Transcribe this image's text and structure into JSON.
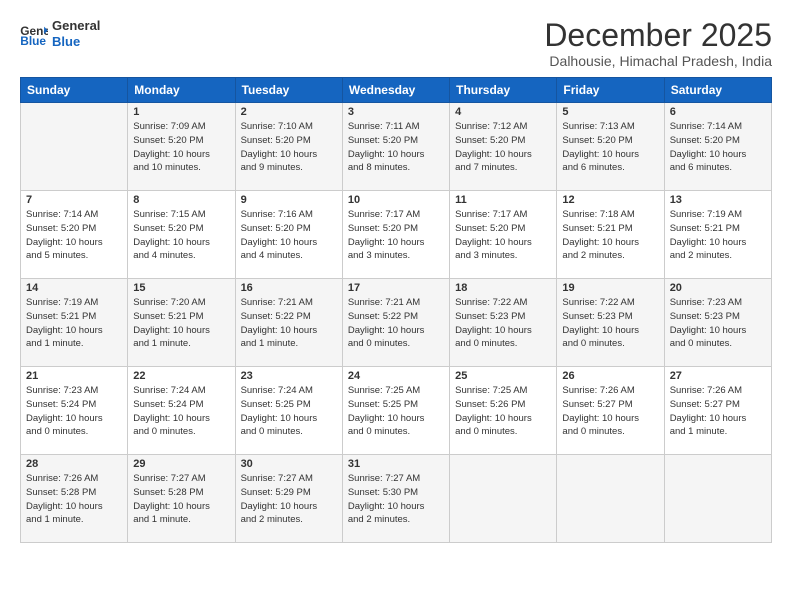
{
  "logo": {
    "line1": "General",
    "line2": "Blue"
  },
  "title": "December 2025",
  "location": "Dalhousie, Himachal Pradesh, India",
  "weekdays": [
    "Sunday",
    "Monday",
    "Tuesday",
    "Wednesday",
    "Thursday",
    "Friday",
    "Saturday"
  ],
  "weeks": [
    [
      {
        "day": "",
        "info": ""
      },
      {
        "day": "1",
        "info": "Sunrise: 7:09 AM\nSunset: 5:20 PM\nDaylight: 10 hours\nand 10 minutes."
      },
      {
        "day": "2",
        "info": "Sunrise: 7:10 AM\nSunset: 5:20 PM\nDaylight: 10 hours\nand 9 minutes."
      },
      {
        "day": "3",
        "info": "Sunrise: 7:11 AM\nSunset: 5:20 PM\nDaylight: 10 hours\nand 8 minutes."
      },
      {
        "day": "4",
        "info": "Sunrise: 7:12 AM\nSunset: 5:20 PM\nDaylight: 10 hours\nand 7 minutes."
      },
      {
        "day": "5",
        "info": "Sunrise: 7:13 AM\nSunset: 5:20 PM\nDaylight: 10 hours\nand 6 minutes."
      },
      {
        "day": "6",
        "info": "Sunrise: 7:14 AM\nSunset: 5:20 PM\nDaylight: 10 hours\nand 6 minutes."
      }
    ],
    [
      {
        "day": "7",
        "info": "Sunrise: 7:14 AM\nSunset: 5:20 PM\nDaylight: 10 hours\nand 5 minutes."
      },
      {
        "day": "8",
        "info": "Sunrise: 7:15 AM\nSunset: 5:20 PM\nDaylight: 10 hours\nand 4 minutes."
      },
      {
        "day": "9",
        "info": "Sunrise: 7:16 AM\nSunset: 5:20 PM\nDaylight: 10 hours\nand 4 minutes."
      },
      {
        "day": "10",
        "info": "Sunrise: 7:17 AM\nSunset: 5:20 PM\nDaylight: 10 hours\nand 3 minutes."
      },
      {
        "day": "11",
        "info": "Sunrise: 7:17 AM\nSunset: 5:20 PM\nDaylight: 10 hours\nand 3 minutes."
      },
      {
        "day": "12",
        "info": "Sunrise: 7:18 AM\nSunset: 5:21 PM\nDaylight: 10 hours\nand 2 minutes."
      },
      {
        "day": "13",
        "info": "Sunrise: 7:19 AM\nSunset: 5:21 PM\nDaylight: 10 hours\nand 2 minutes."
      }
    ],
    [
      {
        "day": "14",
        "info": "Sunrise: 7:19 AM\nSunset: 5:21 PM\nDaylight: 10 hours\nand 1 minute."
      },
      {
        "day": "15",
        "info": "Sunrise: 7:20 AM\nSunset: 5:21 PM\nDaylight: 10 hours\nand 1 minute."
      },
      {
        "day": "16",
        "info": "Sunrise: 7:21 AM\nSunset: 5:22 PM\nDaylight: 10 hours\nand 1 minute."
      },
      {
        "day": "17",
        "info": "Sunrise: 7:21 AM\nSunset: 5:22 PM\nDaylight: 10 hours\nand 0 minutes."
      },
      {
        "day": "18",
        "info": "Sunrise: 7:22 AM\nSunset: 5:23 PM\nDaylight: 10 hours\nand 0 minutes."
      },
      {
        "day": "19",
        "info": "Sunrise: 7:22 AM\nSunset: 5:23 PM\nDaylight: 10 hours\nand 0 minutes."
      },
      {
        "day": "20",
        "info": "Sunrise: 7:23 AM\nSunset: 5:23 PM\nDaylight: 10 hours\nand 0 minutes."
      }
    ],
    [
      {
        "day": "21",
        "info": "Sunrise: 7:23 AM\nSunset: 5:24 PM\nDaylight: 10 hours\nand 0 minutes."
      },
      {
        "day": "22",
        "info": "Sunrise: 7:24 AM\nSunset: 5:24 PM\nDaylight: 10 hours\nand 0 minutes."
      },
      {
        "day": "23",
        "info": "Sunrise: 7:24 AM\nSunset: 5:25 PM\nDaylight: 10 hours\nand 0 minutes."
      },
      {
        "day": "24",
        "info": "Sunrise: 7:25 AM\nSunset: 5:25 PM\nDaylight: 10 hours\nand 0 minutes."
      },
      {
        "day": "25",
        "info": "Sunrise: 7:25 AM\nSunset: 5:26 PM\nDaylight: 10 hours\nand 0 minutes."
      },
      {
        "day": "26",
        "info": "Sunrise: 7:26 AM\nSunset: 5:27 PM\nDaylight: 10 hours\nand 0 minutes."
      },
      {
        "day": "27",
        "info": "Sunrise: 7:26 AM\nSunset: 5:27 PM\nDaylight: 10 hours\nand 1 minute."
      }
    ],
    [
      {
        "day": "28",
        "info": "Sunrise: 7:26 AM\nSunset: 5:28 PM\nDaylight: 10 hours\nand 1 minute."
      },
      {
        "day": "29",
        "info": "Sunrise: 7:27 AM\nSunset: 5:28 PM\nDaylight: 10 hours\nand 1 minute."
      },
      {
        "day": "30",
        "info": "Sunrise: 7:27 AM\nSunset: 5:29 PM\nDaylight: 10 hours\nand 2 minutes."
      },
      {
        "day": "31",
        "info": "Sunrise: 7:27 AM\nSunset: 5:30 PM\nDaylight: 10 hours\nand 2 minutes."
      },
      {
        "day": "",
        "info": ""
      },
      {
        "day": "",
        "info": ""
      },
      {
        "day": "",
        "info": ""
      }
    ]
  ]
}
